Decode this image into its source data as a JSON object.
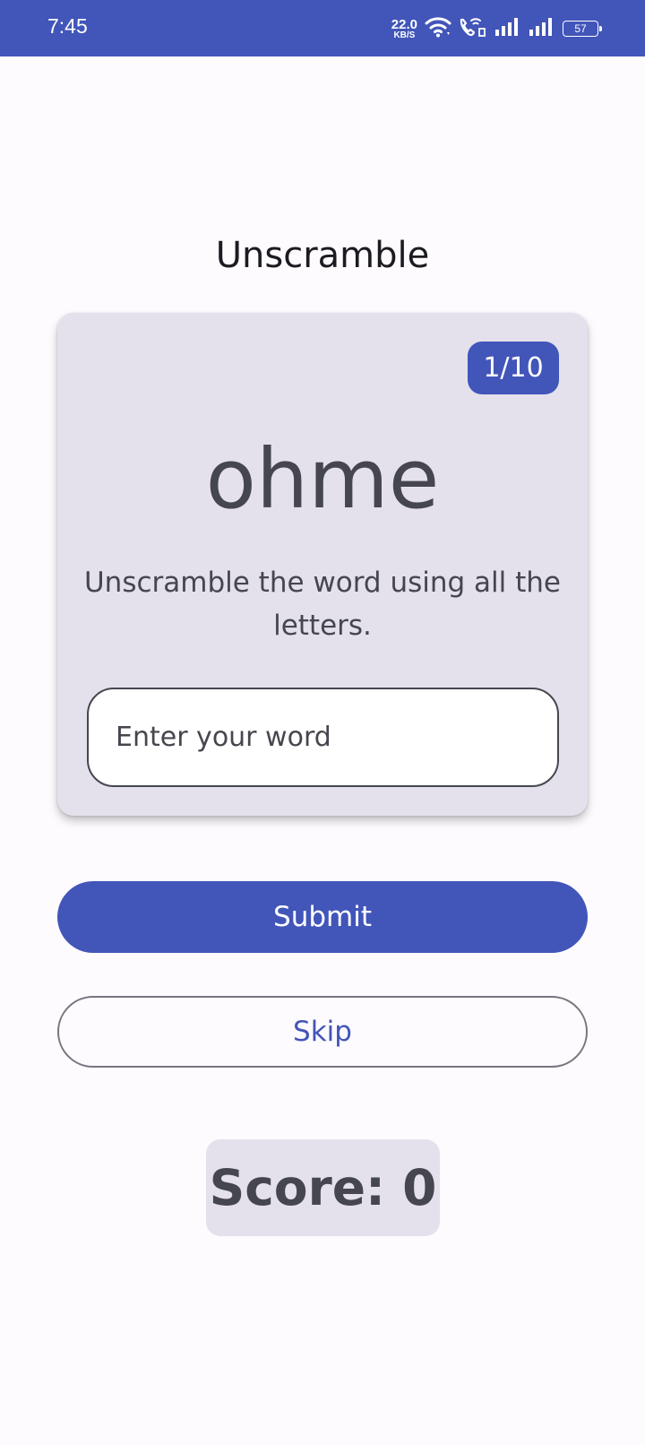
{
  "status_bar": {
    "time": "7:45",
    "net_speed_value": "22.0",
    "net_speed_unit": "KB/S",
    "battery_level": "57",
    "icons": [
      "wifi-icon",
      "wifi-calling-icon",
      "signal-icon",
      "signal-icon",
      "battery-icon"
    ]
  },
  "app": {
    "title": "Unscramble"
  },
  "game": {
    "word_count": "1/10",
    "scrambled_word": "ohme",
    "instructions": "Unscramble the word using all the letters.",
    "input_value": "",
    "input_placeholder": "Enter your word"
  },
  "actions": {
    "submit_label": "Submit",
    "skip_label": "Skip"
  },
  "score": {
    "label": "Score: 0"
  },
  "colors": {
    "primary": "#4255b9",
    "surface_variant": "#e4e1ec",
    "background": "#fefbff",
    "on_surface_variant": "#46464f",
    "outline": "#777680"
  }
}
